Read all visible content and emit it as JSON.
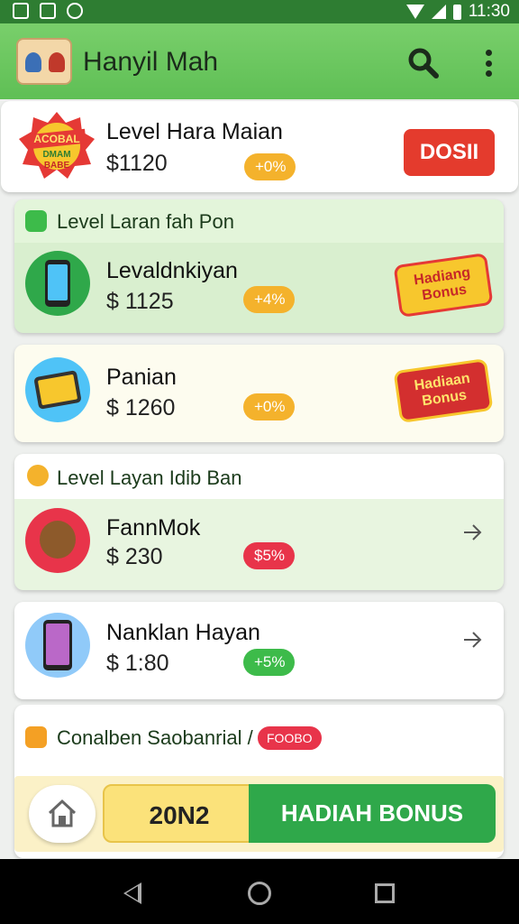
{
  "status_bar": {
    "time": "11:30"
  },
  "app_bar": {
    "title": "Hanyil Mah"
  },
  "featured": {
    "name": "Level Hara Maian",
    "price": "$1120",
    "badge": "+0%",
    "button": "DOSII",
    "logo_text_1": "ACOBAL",
    "logo_text_2": "DMAM",
    "logo_text_3": "BABE"
  },
  "section1": {
    "title": "Level Laran fah Pon",
    "items": [
      {
        "name": "Levaldnkiyan",
        "price": "$ 1125",
        "badge": "+4%",
        "bonus": "Hadiang Bonus"
      },
      {
        "name": "Panian",
        "price": "$ 1260",
        "badge": "+0%",
        "bonus": "Hadiaan Bonus"
      }
    ]
  },
  "section2": {
    "title": "Level Layan Idib Ban",
    "items": [
      {
        "name": "FannMok",
        "price": "$ 230",
        "badge": "$5%"
      },
      {
        "name": "Nanklan Hayan",
        "price": "$ 1:80",
        "badge": "+5%"
      }
    ]
  },
  "section3": {
    "title": "Conalben Saobanrial /",
    "tag": "FOOBO"
  },
  "bottom": {
    "code": "20N2",
    "bonus_button": "HADIAH BONUS"
  },
  "colors": {
    "primary": "#5fbf55",
    "accent_red": "#e43b2d",
    "accent_orange": "#f4b22c",
    "accent_green": "#2fa84a"
  }
}
